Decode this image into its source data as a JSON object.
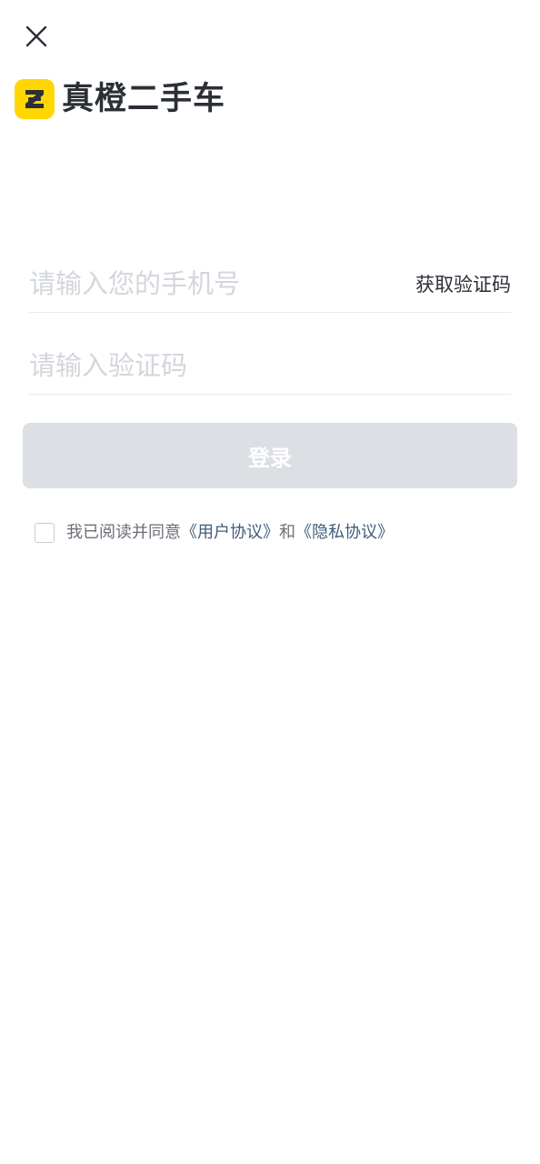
{
  "header": {
    "close_icon": "close-icon"
  },
  "brand": {
    "logo_icon": "z-logo-icon",
    "logo_color": "#FFD600",
    "name": "真橙二手车"
  },
  "form": {
    "phone": {
      "placeholder": "请输入您的手机号",
      "value": "",
      "get_code_label": "获取验证码"
    },
    "code": {
      "placeholder": "请输入验证码",
      "value": ""
    },
    "login_label": "登录",
    "login_enabled": false
  },
  "agreement": {
    "checked": false,
    "prefix": "我已阅读并同意",
    "user_agreement": "《用户协议》",
    "conjunction": "和",
    "privacy_agreement": "《隐私协议》"
  }
}
